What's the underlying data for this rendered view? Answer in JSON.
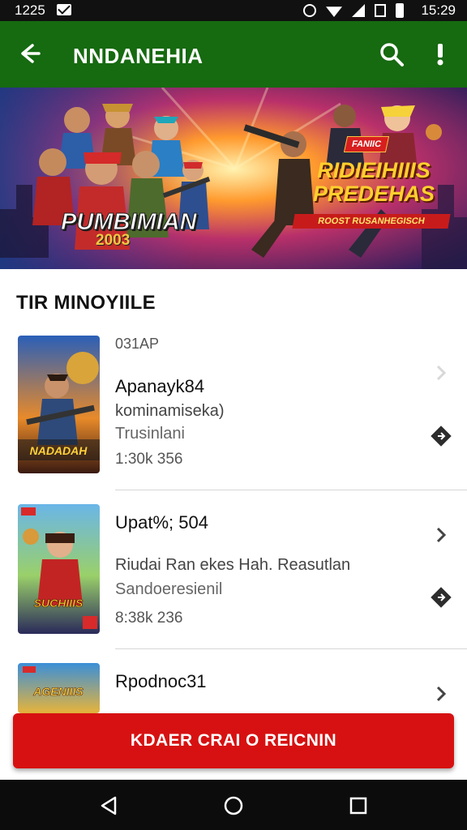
{
  "status_bar": {
    "time_left": "1225",
    "time_right": "15:29",
    "icons": [
      "mail-icon",
      "alarm-icon",
      "wifi-icon",
      "signal-icon",
      "photo-icon",
      "battery-icon"
    ]
  },
  "app_bar": {
    "title": "NNDANEHIA",
    "background": "#166a10",
    "back_icon": "arrow-left-icon",
    "search_icon": "search-icon",
    "more_icon": "exclamation-icon"
  },
  "banner": {
    "left_title": "PUMBIMIAN",
    "left_year": "2003",
    "right_badge": "FANIIC",
    "right_title": "RIDIEIHIIIS PREDEHAS",
    "right_subtitle": "ROOST RUSANHEGISCH"
  },
  "section": {
    "title": "TIR MINOYIILE"
  },
  "items": [
    {
      "tag": "031AP",
      "name": "Apanayk84",
      "line1": "kominamiseka)",
      "line2": "Trusinlani",
      "meta": "1:30k 356",
      "thumb_label": "NADADAH"
    },
    {
      "tag": "",
      "name": "Upat%; 504",
      "line1": "Riudai Ran  ekes Hah. Reasutlan",
      "line2": "Sandoeresienil",
      "meta": "8:38k 236",
      "thumb_label": "SUCHIIIS"
    },
    {
      "tag": "",
      "name": "Rpodnoc31",
      "line1": "",
      "line2": "",
      "meta": "",
      "thumb_label": "AGENIIIS"
    }
  ],
  "cta": {
    "label": "KDAER CRAI O REICNIN",
    "color": "#d71111"
  },
  "nav_bar": {
    "back_icon": "triangle-back-icon",
    "home_icon": "circle-home-icon",
    "recents_icon": "square-recents-icon"
  }
}
